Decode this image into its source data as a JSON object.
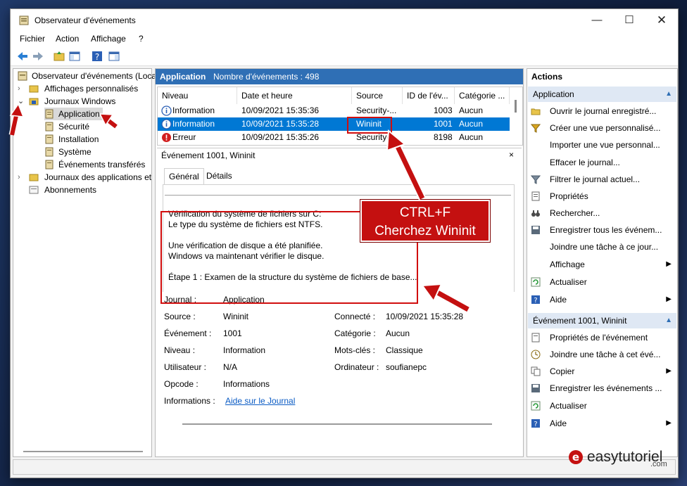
{
  "window": {
    "title": "Observateur d'événements"
  },
  "menu": [
    "Fichier",
    "Action",
    "Affichage",
    "?"
  ],
  "tree": {
    "root": "Observateur d'événements (Loca",
    "custom_views": "Affichages personnalisés",
    "windows_logs": "Journaux Windows",
    "application": "Application",
    "security": "Sécurité",
    "setup": "Installation",
    "system": "Système",
    "forwarded": "Événements transférés",
    "app_services": "Journaux des applications et",
    "subscriptions": "Abonnements"
  },
  "middle": {
    "header_title": "Application",
    "header_count": "Nombre d'événements : 498",
    "columns": [
      "Niveau",
      "Date et heure",
      "Source",
      "ID de l'év...",
      "Catégorie ..."
    ],
    "rows": [
      {
        "level": "Information",
        "date": "10/09/2021 15:35:36",
        "source": "Security-...",
        "id": "1003",
        "category": "Aucun"
      },
      {
        "level": "Information",
        "date": "10/09/2021 15:35:28",
        "source": "Wininit",
        "id": "1001",
        "category": "Aucun"
      },
      {
        "level": "Erreur",
        "date": "10/09/2021 15:35:26",
        "source": "Security-...",
        "id": "8198",
        "category": "Aucun"
      }
    ]
  },
  "detail": {
    "title": "Événement 1001, Wininit",
    "close": "×",
    "tab_general": "Général",
    "tab_details": "Détails",
    "lines": [
      "Vérification du système de fichiers sur C:",
      "Le type du système de fichiers est NTFS.",
      "Une vérification de disque a été planifiée.",
      "Windows va maintenant vérifier le disque.",
      "Étape 1 : Examen de la structure du système de fichiers de base..."
    ],
    "journal_label": "Journal :",
    "journal_value": "Application",
    "source_label": "Source :",
    "source_value": "Wininit",
    "connected_label": "Connecté :",
    "connected_value": "10/09/2021 15:35:28",
    "event_label": "Événement :",
    "event_value": "1001",
    "category_label": "Catégorie :",
    "category_value": "Aucun",
    "level_label": "Niveau :",
    "level_value": "Information",
    "keywords_label": "Mots-clés :",
    "keywords_value": "Classique",
    "user_label": "Utilisateur :",
    "user_value": "N/A",
    "computer_label": "Ordinateur :",
    "computer_value": "soufianepc",
    "opcode_label": "Opcode :",
    "opcode_value": "Informations",
    "info_label": "Informations :",
    "info_link": "Aide sur le Journal"
  },
  "actions": {
    "header": "Actions",
    "section1": "Application",
    "items1": [
      "Ouvrir le journal enregistré...",
      "Créer une vue personnalisé...",
      "Importer une vue personnal...",
      "Effacer le journal...",
      "Filtrer le journal actuel...",
      "Propriétés",
      "Rechercher...",
      "Enregistrer tous les événem...",
      "Joindre une tâche à ce jour...",
      "Affichage",
      "Actualiser",
      "Aide"
    ],
    "section2": "Événement 1001, Wininit",
    "items2": [
      "Propriétés de l'événement",
      "Joindre une tâche à cet évé...",
      "Copier",
      "Enregistrer les événements ...",
      "Actualiser",
      "Aide"
    ]
  },
  "callout": {
    "line1": "CTRL+F",
    "line2": "Cherchez Wininit"
  },
  "logo": {
    "text": "easytutoriel",
    "sub": ".com"
  },
  "colors": {
    "selection": "#0078d4",
    "header": "#2f6fb5",
    "annotation": "#d10e0e"
  }
}
